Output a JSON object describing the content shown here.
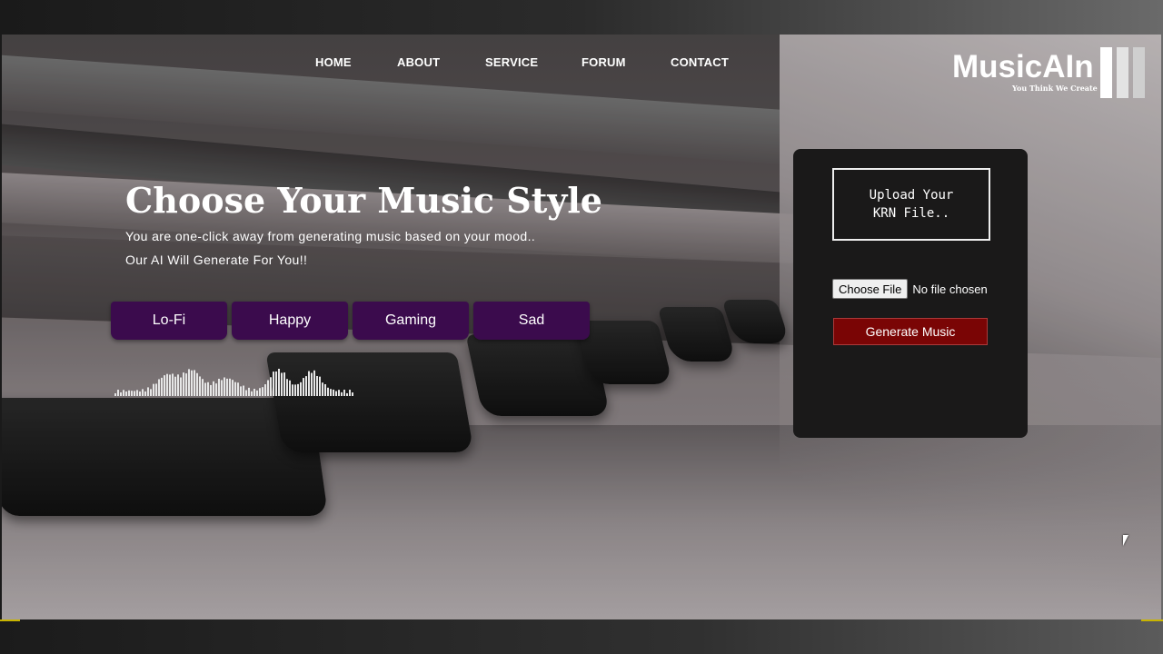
{
  "nav": {
    "items": [
      "HOME",
      "ABOUT",
      "SERVICE",
      "FORUM",
      "CONTACT"
    ]
  },
  "logo": {
    "name": "MusicAIn",
    "tagline": "You Think We Create"
  },
  "hero": {
    "title": "Choose Your Music Style",
    "line1": "You are one-click away from generating music based on your mood..",
    "line2": "Our AI Will Generate For You!!"
  },
  "styles": [
    "Lo-Fi",
    "Happy",
    "Gaming",
    "Sad"
  ],
  "upload_panel": {
    "box_line1": "Upload Your",
    "box_line2": "KRN File..",
    "file_button": "Choose File",
    "file_status": "No file chosen",
    "generate_button": "Generate Music"
  },
  "colors": {
    "style_button_bg": "#3b0b4d",
    "generate_button_bg": "#7a0505",
    "panel_bg": "#1a1919"
  },
  "icons": [
    "audio-waveform-icon",
    "mouse-cursor-icon"
  ]
}
